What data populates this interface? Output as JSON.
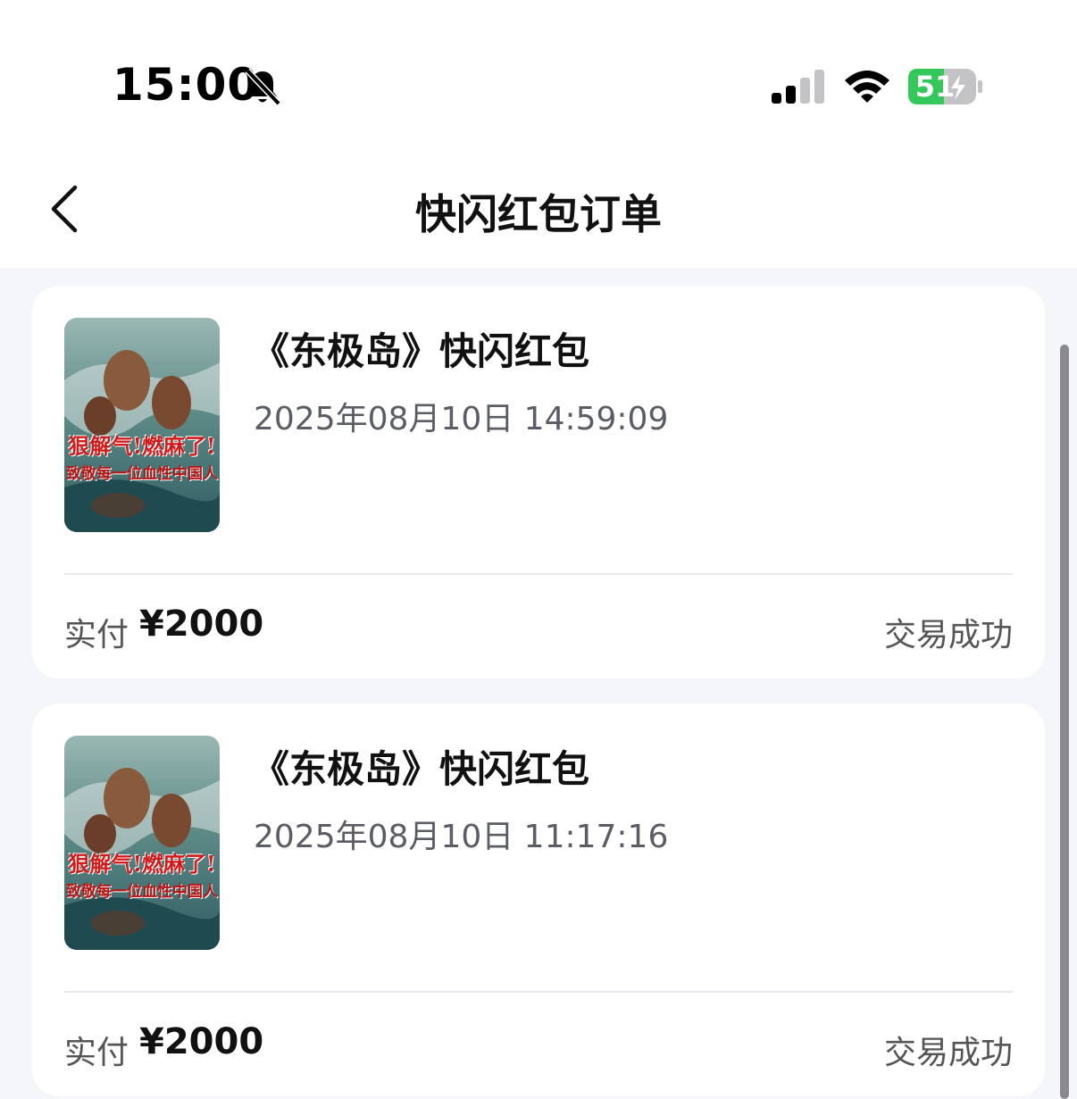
{
  "status_bar": {
    "time": "15:00",
    "battery_level": "51",
    "icons": [
      "bell-slash-icon",
      "signal-icon",
      "wifi-icon",
      "battery-charging-icon"
    ]
  },
  "nav": {
    "title": "快闪红包订单",
    "back_icon": "chevron-left-icon"
  },
  "orders": [
    {
      "title": "《东极岛》快闪红包",
      "datetime": "2025年08月10日 14:59:09",
      "cover_line1": "狠解气!燃麻了!",
      "cover_line2": "致敬每一位血性中国人",
      "paid_label": "实付",
      "paid_amount": "¥2000",
      "status": "交易成功"
    },
    {
      "title": "《东极岛》快闪红包",
      "datetime": "2025年08月10日 11:17:16",
      "cover_line1": "狠解气!燃麻了!",
      "cover_line2": "致敬每一位血性中国人",
      "paid_label": "实付",
      "paid_amount": "¥2000",
      "status": "交易成功"
    }
  ],
  "colors": {
    "background": "#f5f6fa",
    "card": "#ffffff",
    "battery_green": "#34c759",
    "cover_red": "#d11a1a"
  }
}
